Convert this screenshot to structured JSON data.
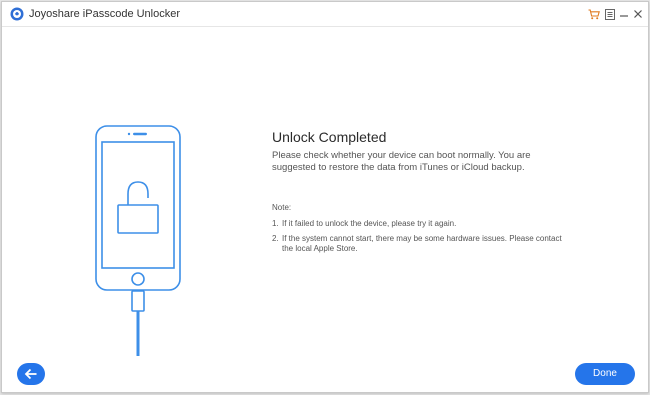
{
  "window": {
    "title": "Joyoshare iPasscode Unlocker"
  },
  "titlebar": {
    "icons": [
      "cart-icon",
      "menu-icon",
      "minimize-icon",
      "close-icon"
    ]
  },
  "colors": {
    "accent": "#2575ea",
    "illustration": "#3d8fe8"
  },
  "main": {
    "heading": "Unlock Completed",
    "description": "Please check whether your device can boot normally. You are suggested to restore the data from iTunes or iCloud backup.",
    "note_title": "Note:",
    "notes": [
      {
        "num": "1.",
        "text": "If it failed to unlock the device, please try it again."
      },
      {
        "num": "2.",
        "text": "If the system cannot start, there may be some hardware issues. Please contact the local Apple Store."
      }
    ]
  },
  "footer": {
    "back_icon": "arrow-left-icon",
    "done_label": "Done"
  }
}
